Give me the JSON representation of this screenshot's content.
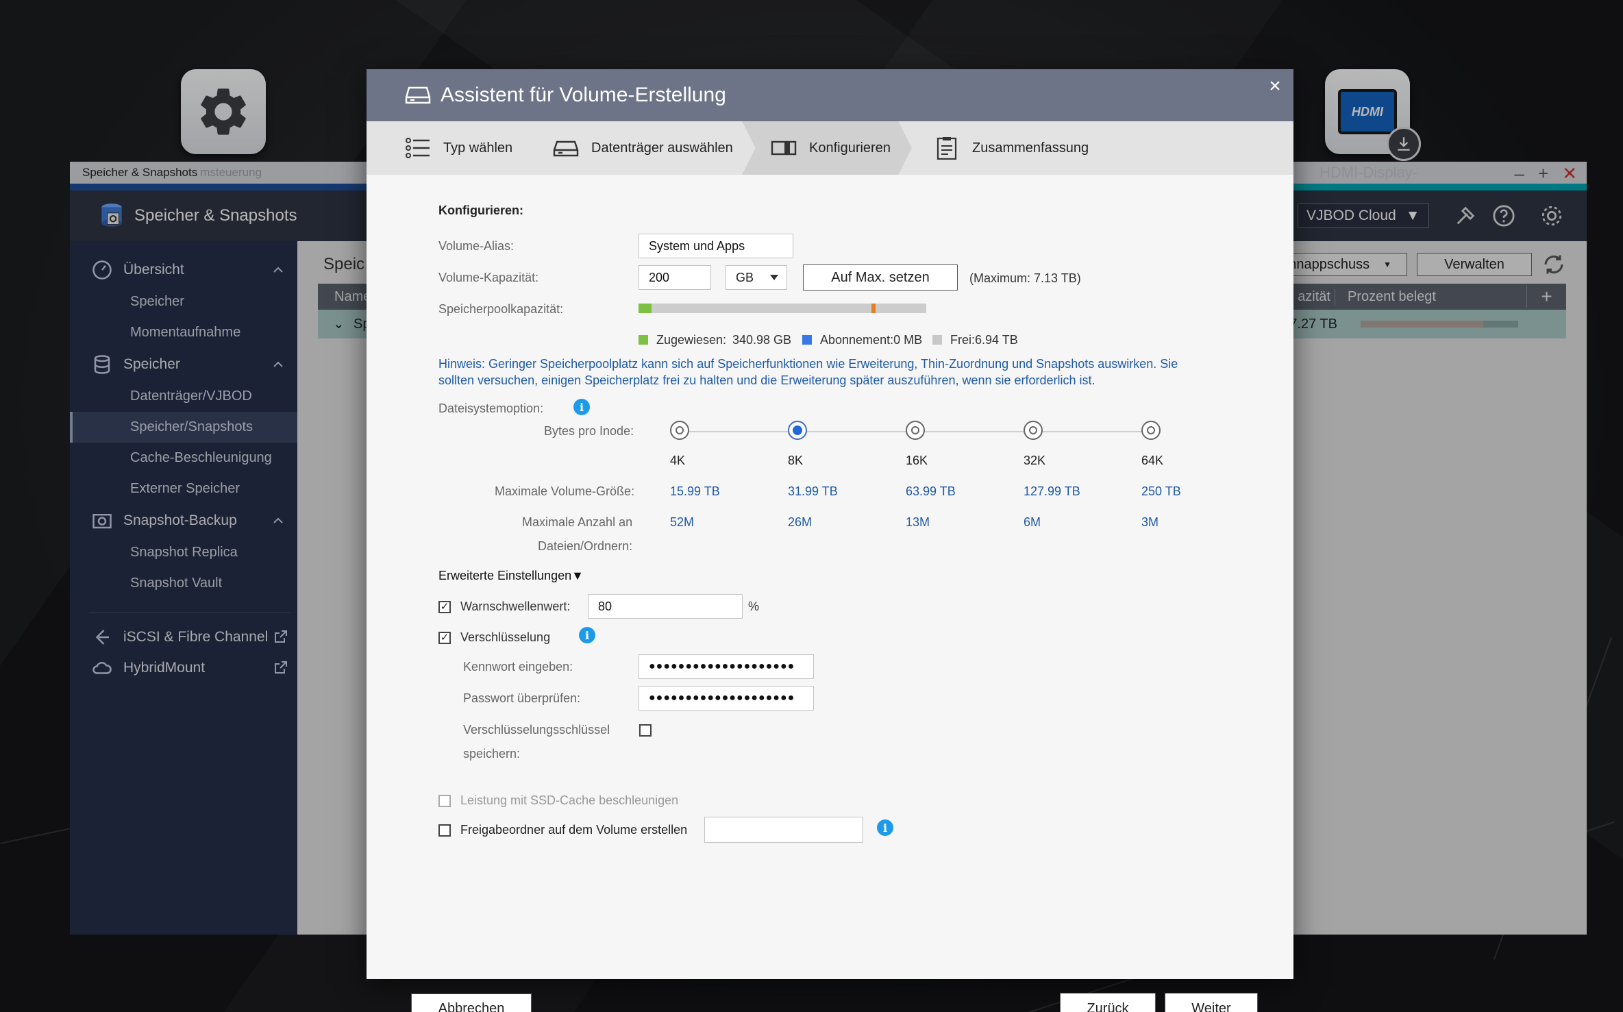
{
  "desktop": {
    "icon_left": "settings-gear",
    "icon_right": "hdmi-display"
  },
  "bg_window": {
    "title": "Speicher & Snapshots",
    "title_ghost": "msteuerung",
    "title_ghost_right": "HDMI-Display-",
    "app_name": "Speicher & Snapshots",
    "vjbod_label": "VJBOD Cloud",
    "main_title": "Speic",
    "table_headers": [
      "Name",
      "azität",
      "Prozent belegt"
    ],
    "row_prefix": "Sp",
    "row_capacity": "7.27 TB",
    "row_used_fraction": 0.78,
    "btn_snapshot": "hnappschuss",
    "btn_manage": "Verwalten",
    "sidebar": {
      "groups": [
        {
          "label": "Übersicht",
          "items": [
            "Speicher",
            "Momentaufnahme"
          ]
        },
        {
          "label": "Speicher",
          "items": [
            "Datenträger/VJBOD",
            "Speicher/Snapshots",
            "Cache-Beschleunigung",
            "Externer Speicher"
          ]
        },
        {
          "label": "Snapshot-Backup",
          "items": [
            "Snapshot Replica",
            "Snapshot Vault"
          ]
        }
      ],
      "external": [
        "iSCSI & Fibre Channel",
        "HybridMount"
      ],
      "active_item": "Speicher/Snapshots"
    }
  },
  "dialog": {
    "title": "Assistent für Volume-Erstellung",
    "close": "×",
    "steps": [
      "Typ wählen",
      "Datenträger auswählen",
      "Konfigurieren",
      "Zusammenfassung"
    ],
    "active_step": "Konfigurieren",
    "section_title": "Konfigurieren:",
    "alias_label": "Volume-Alias:",
    "alias_value": "System und Apps",
    "capacity_label": "Volume-Kapazität:",
    "capacity_value": "200",
    "capacity_unit": "GB",
    "max_button": "Auf Max. setzen",
    "max_text": "(Maximum: 7.13 TB)",
    "pool_label": "Speicherpoolkapazität:",
    "pool_used_fraction": 0.045,
    "pool_marker_fraction": 0.81,
    "legend": {
      "allocated": "Zugewiesen:",
      "allocated_value": "340.98 GB",
      "subscription": "Abonnement:0 MB",
      "free": "Frei:6.94 TB"
    },
    "legend_colors": {
      "allocated": "#7cc142",
      "subscription": "#3b78e7",
      "free": "#c8c8c8"
    },
    "hint_line1": "Hinweis: Geringer Speicherpoolplatz kann sich auf Speicherfunktionen wie Erweiterung, Thin-Zuordnung und Snapshots auswirken. Sie",
    "hint_line2": "sollten versuchen, einigen Speicherplatz frei zu halten und die Erweiterung später auszuführen, wenn sie erforderlich ist.",
    "fs_option_label": "Dateisystemoption:",
    "bytes_per_inode_label": "Bytes pro Inode:",
    "inode_options": [
      "4K",
      "8K",
      "16K",
      "32K",
      "64K"
    ],
    "inode_selected": "8K",
    "max_volume_label": "Maximale Volume-Größe:",
    "max_volume_values": [
      "15.99 TB",
      "31.99 TB",
      "63.99 TB",
      "127.99 TB",
      "250 TB"
    ],
    "max_files_label_1": "Maximale Anzahl an",
    "max_files_label_2": "Dateien/Ordnern:",
    "max_files_values": [
      "52M",
      "26M",
      "13M",
      "6M",
      "3M"
    ],
    "advanced_label": "Erweiterte Einstellungen▼",
    "warn_label": "Warnschwellenwert:",
    "warn_checked": true,
    "warn_value": "80",
    "warn_unit": "%",
    "encrypt_label": "Verschlüsselung",
    "encrypt_checked": true,
    "pw_label": "Kennwort eingeben:",
    "pw_value": "●●●●●●●●●●●●●●●●●●●●",
    "pw_verify_label": "Passwort überprüfen:",
    "pw_verify_value": "●●●●●●●●●●●●●●●●●●●●",
    "save_key_label_1": "Verschlüsselungsschlüssel",
    "save_key_label_2": "speichern:",
    "save_key_checked": false,
    "ssd_label": "Leistung mit SSD-Cache beschleunigen",
    "ssd_disabled": true,
    "share_label": "Freigabeordner auf dem Volume erstellen",
    "share_value": "",
    "btn_cancel": "Abbrechen",
    "btn_back": "Zurück",
    "btn_next": "Weiter"
  }
}
